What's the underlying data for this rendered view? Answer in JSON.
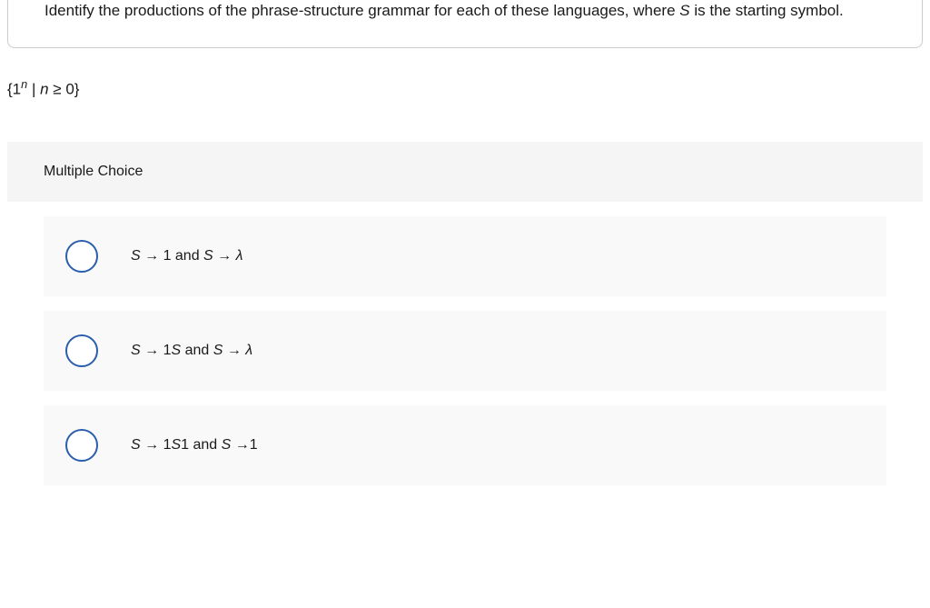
{
  "question": {
    "prefix": "Identify the productions of the phrase-structure grammar for each of these languages, where ",
    "symbol": "S",
    "suffix": " is the starting symbol."
  },
  "subquestion": {
    "open": "{1",
    "exp": "n",
    "mid": " | ",
    "var": "n",
    "cond": " ≥ 0}"
  },
  "sectionLabel": "Multiple Choice",
  "choices": [
    {
      "p1a": "S",
      "p1b": " → 1 and ",
      "p2a": "S",
      "p2b": " → ",
      "lam": "λ"
    },
    {
      "p1a": "S",
      "p1b": " → 1",
      "p1c": "S",
      "p1d": " and ",
      "p2a": "S",
      "p2b": " → ",
      "lam": "λ"
    },
    {
      "p1a": "S",
      "p1b": " → 1",
      "p1c": "S",
      "p1d": "1 and ",
      "p2a": "S",
      "p2b": " →1"
    }
  ]
}
